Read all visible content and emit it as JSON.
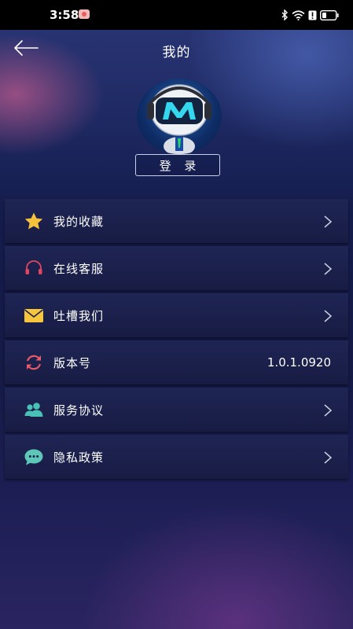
{
  "status_bar": {
    "time": "3:58"
  },
  "header": {
    "title": "我的"
  },
  "profile": {
    "login_label": "登 录"
  },
  "menu": {
    "items": [
      {
        "label": "我的收藏",
        "icon": "star-icon",
        "has_chevron": true
      },
      {
        "label": "在线客服",
        "icon": "headset-icon",
        "has_chevron": true
      },
      {
        "label": "吐槽我们",
        "icon": "mail-icon",
        "has_chevron": true
      },
      {
        "label": "版本号",
        "icon": "refresh-icon",
        "value": "1.0.1.0920"
      },
      {
        "label": "服务协议",
        "icon": "users-icon",
        "has_chevron": true
      },
      {
        "label": "隐私政策",
        "icon": "chat-bubble-icon",
        "has_chevron": true
      }
    ]
  },
  "colors": {
    "star": "#f5c33b",
    "headset": "#e0465f",
    "mail": "#f7c63c",
    "refresh": "#ea5a68",
    "users": "#49c1b5",
    "chat": "#5fc7b8"
  }
}
